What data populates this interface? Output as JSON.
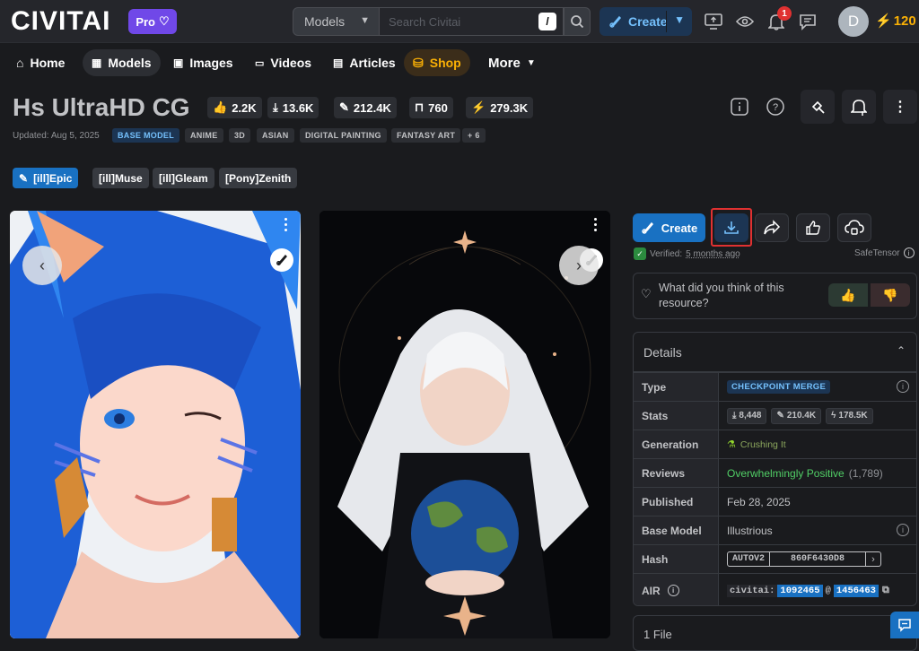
{
  "topbar": {
    "logo": "CIVITAI",
    "pro_label": "Pro",
    "search_category": "Models",
    "search_placeholder": "Search Civitai",
    "search_shortcut": "/",
    "create_label": "Create",
    "notification_count": "1",
    "avatar_initial": "D",
    "buzz_count": "120"
  },
  "nav": {
    "items": [
      "Home",
      "Models",
      "Images",
      "Videos",
      "Articles",
      "Shop",
      "More"
    ],
    "active": "Models"
  },
  "model": {
    "title": "Hs UltraHD CG",
    "stats": {
      "likes": "2.2K",
      "downloads": "13.6K",
      "generations": "212.4K",
      "collections": "760",
      "buzz": "279.3K"
    },
    "updated": "Updated: Aug 5, 2025",
    "base_model_tag": "BASE MODEL",
    "tags": [
      "ANIME",
      "3D",
      "ASIAN",
      "DIGITAL PAINTING",
      "FANTASY ART",
      "+ 6"
    ],
    "versions": [
      "[ill]Epic",
      "[ill]Muse",
      "[ill]Gleam",
      "[Pony]Zenith"
    ],
    "active_version": "[ill]Epic"
  },
  "actions": {
    "create_label": "Create",
    "verified_text": "Verified:",
    "verified_time": "5 months ago",
    "format": "SafeTensor"
  },
  "feedback": {
    "question": "What did you think of this resource?"
  },
  "details": {
    "heading": "Details",
    "rows": {
      "type_label": "Type",
      "type_value": "CHECKPOINT MERGE",
      "stats_label": "Stats",
      "stats_downloads": "8,448",
      "stats_generations": "210.4K",
      "stats_buzz": "178.5K",
      "generation_label": "Generation",
      "generation_value": "Crushing It",
      "reviews_label": "Reviews",
      "reviews_value": "Overwhelmingly Positive",
      "reviews_count": "(1,789)",
      "published_label": "Published",
      "published_value": "Feb 28, 2025",
      "base_label": "Base Model",
      "base_value": "Illustrious",
      "hash_label": "Hash",
      "hash_type": "AUTOV2",
      "hash_value": "860F6430D8",
      "air_label": "AIR",
      "air_prefix": "civitai:",
      "air_model": "1092465",
      "air_at": "@",
      "air_version": "1456463"
    }
  },
  "files_label": "1 File",
  "colors": {
    "accent": "#1971c2",
    "positive": "#51cf66",
    "buzz": "#fab005",
    "highlight_border": "#e03131"
  }
}
